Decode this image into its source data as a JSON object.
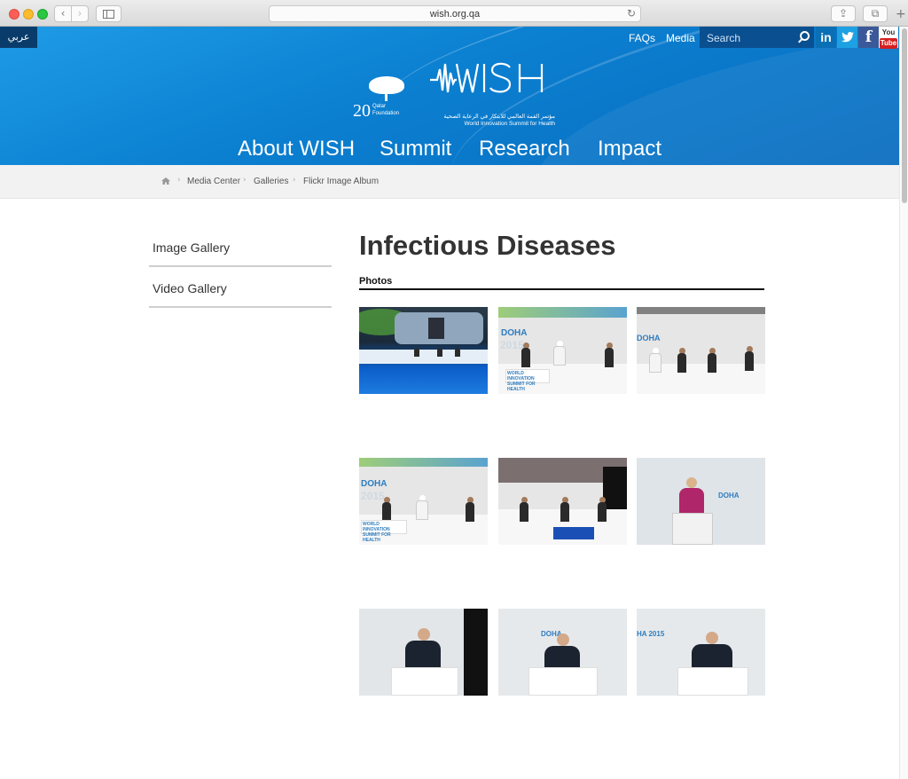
{
  "browser": {
    "url": "wish.org.qa"
  },
  "header": {
    "arabic_label": "عربي",
    "links": [
      "FAQs",
      "Media"
    ],
    "search_placeholder": "Search",
    "social": [
      "linkedin",
      "twitter",
      "facebook",
      "youtube"
    ],
    "youtube_top": "You",
    "youtube_bottom": "Tube",
    "qf_number": "20",
    "qf_name": "Qatar Foundation",
    "wish_arabic": "مؤتمر القمة العالمي للابتكار في الرعاية الصحية",
    "wish_english": "World Innovation Summit for Health",
    "nav": [
      "About WISH",
      "Summit",
      "Research",
      "Impact"
    ]
  },
  "breadcrumb": [
    "Media Center",
    "Galleries",
    "Flickr Image Album"
  ],
  "sidebar": {
    "items": [
      "Image Gallery",
      "Video Gallery"
    ]
  },
  "main": {
    "title": "Infectious Diseases",
    "photos_label": "Photos",
    "thumbnail_count": 9,
    "thumb_labels": {
      "doha": "DOHA",
      "year": "2015",
      "wish_banner": "WORLD INNOVATION SUMMIT FOR HEALTH"
    }
  },
  "colors": {
    "header_blue": "#0b7fd0",
    "search_bg": "#0a4f8f",
    "arabic_bg": "#0a3c6b"
  }
}
